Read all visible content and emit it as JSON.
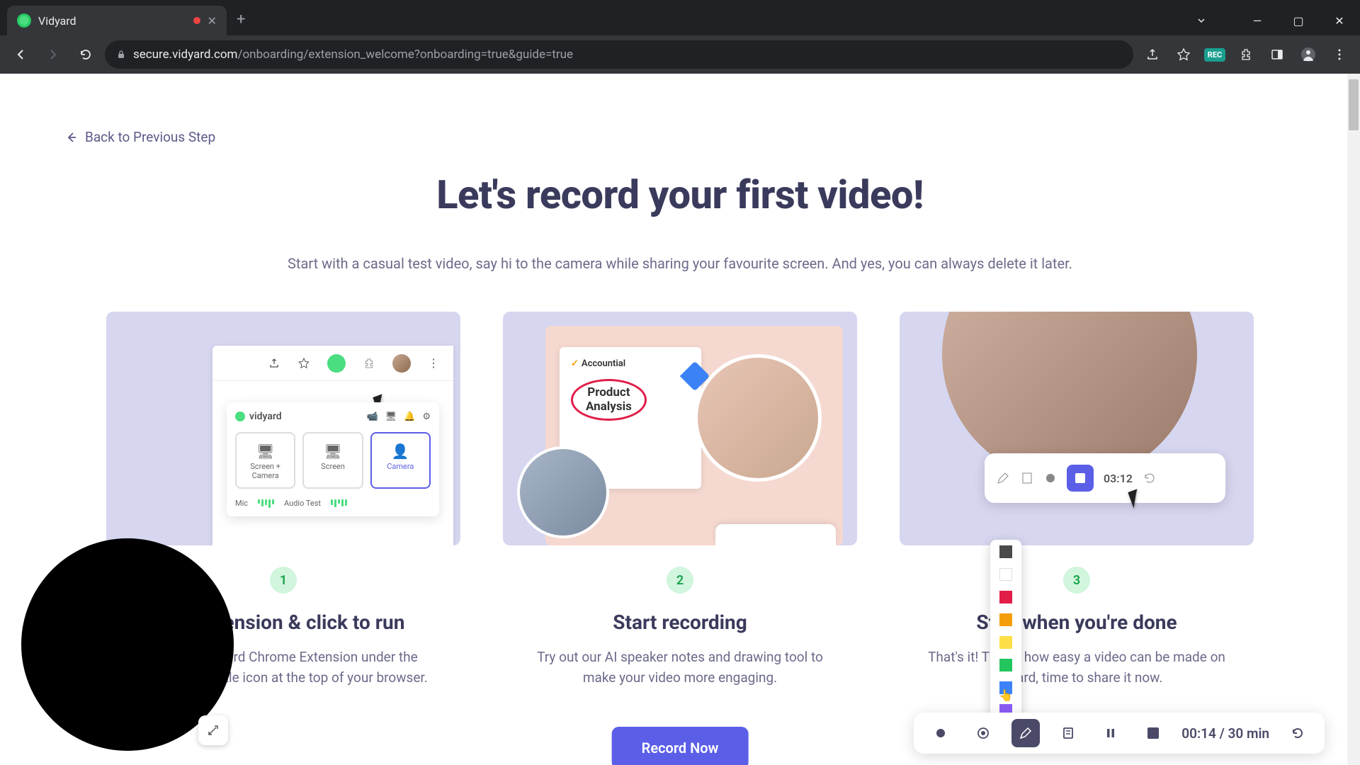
{
  "browser": {
    "tab_title": "Vidyard",
    "url_domain": "secure.vidyard.com",
    "url_path": "/onboarding/extension_welcome?onboarding=true&guide=true",
    "rec_badge": "REC"
  },
  "page": {
    "back_link": "Back to Previous Step",
    "title": "Let's record your first video!",
    "subtitle": "Start with a casual test video, say hi to the camera while sharing your favourite screen. And yes, you can always delete it later.",
    "cta": "Record Now"
  },
  "steps": [
    {
      "num": "1",
      "title": "Pin extension & click to run",
      "desc": "Find the Vidyard Chrome Extension under the extension puzzle icon at the top of your browser.",
      "thumb": {
        "logo": "vidyard",
        "opt1": "Screen + Camera",
        "opt2": "Screen",
        "opt3": "Camera",
        "mic": "Mic",
        "audio": "Audio Test"
      }
    },
    {
      "num": "2",
      "title": "Start recording",
      "desc": "Try out our AI speaker notes and drawing tool to make your video more engaging.",
      "thumb": {
        "brand": "Accountial",
        "circled": "Product\nAnalysis"
      }
    },
    {
      "num": "3",
      "title": "Stop when you're done",
      "desc": "That's it! This is how easy a video can be made on Vidyard, time to share it now.",
      "thumb": {
        "time": "03:12"
      }
    }
  ],
  "rec_toolbar": {
    "time_elapsed": "00:14",
    "time_sep": " / ",
    "time_max": "30 min"
  },
  "color_picker": {
    "colors": [
      "#4a4a4a",
      "#ffffff",
      "#e11d48",
      "#f59e0b",
      "#fde047",
      "#22c55e",
      "#3b82f6",
      "#8b5cf6"
    ]
  }
}
